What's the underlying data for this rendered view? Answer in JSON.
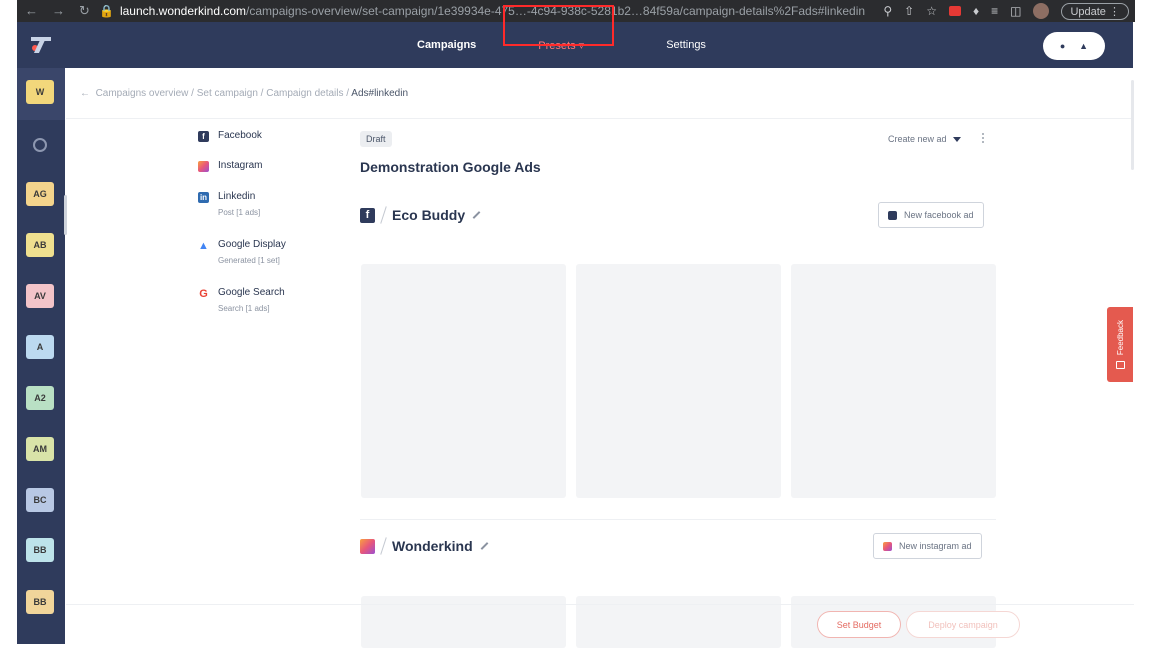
{
  "browser": {
    "url_host": "launch.wonderkind.com",
    "url_path": "/campaigns-overview/set-campaign/1e39934e-475…-4c94-938c-5281b2…84f59a/campaign-details%2Fads#linkedin",
    "update_label": "Update"
  },
  "topnav": {
    "campaigns": "Campaigns",
    "presets": "Presets",
    "settings": "Settings"
  },
  "sidebar": {
    "workspaces": [
      {
        "label": "W",
        "color": "#f2d77b"
      },
      {
        "label": "AG",
        "color": "#f4d48c"
      },
      {
        "label": "AB",
        "color": "#efe08f"
      },
      {
        "label": "AV",
        "color": "#f3c4c9"
      },
      {
        "label": "A",
        "color": "#bcd9f0"
      },
      {
        "label": "A2",
        "color": "#b9e0c4"
      },
      {
        "label": "AM",
        "color": "#d9e3a8"
      },
      {
        "label": "BC",
        "color": "#b8c8e4"
      },
      {
        "label": "BB",
        "color": "#bde3ea"
      },
      {
        "label": "BB",
        "color": "#f1d59a"
      }
    ]
  },
  "breadcrumb": {
    "items": [
      "Campaigns overview",
      "Set campaign",
      "Campaign details"
    ],
    "current": "Ads#linkedin"
  },
  "channels": [
    {
      "name": "Facebook",
      "sub": "",
      "icon": "facebook-icon",
      "color": "#2f3b5c"
    },
    {
      "name": "Instagram",
      "sub": "",
      "icon": "instagram-icon",
      "color": "#e8577a"
    },
    {
      "name": "Linkedin",
      "sub": "Post [1 ads]",
      "icon": "linkedin-icon",
      "color": "#2f6bb0"
    },
    {
      "name": "Google Display",
      "sub": "Generated [1 set]",
      "icon": "google-ads-icon",
      "color": "#4285f4"
    },
    {
      "name": "Google Search",
      "sub": "Search [1 ads]",
      "icon": "google-icon",
      "color": "#ea4335"
    }
  ],
  "main": {
    "status": "Draft",
    "create_new_ad": "Create new ad",
    "title": "Demonstration Google Ads",
    "sections": [
      {
        "name": "Eco Buddy",
        "button": "New facebook ad"
      },
      {
        "name": "Wonderkind",
        "button": "New instagram ad"
      }
    ]
  },
  "footer": {
    "set_budget": "Set Budget",
    "deploy": "Deploy campaign"
  },
  "feedback": "Feedback"
}
